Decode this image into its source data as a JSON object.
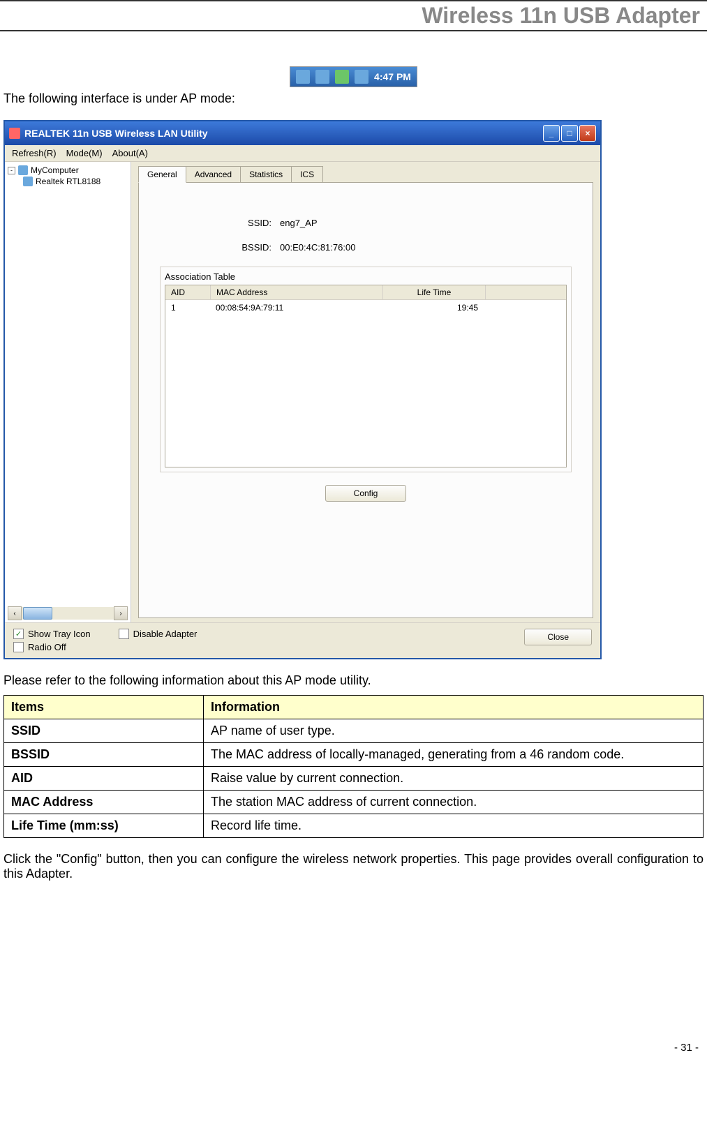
{
  "header_title": "Wireless 11n USB Adapter",
  "tray": {
    "time": "4:47 PM"
  },
  "intro_text": "The following interface is under AP mode:",
  "app": {
    "title": "REALTEK 11n USB Wireless LAN Utility",
    "menu": {
      "refresh": "Refresh(R)",
      "mode": "Mode(M)",
      "about": "About(A)"
    },
    "tree": {
      "root": "MyComputer",
      "child": "Realtek RTL8188"
    },
    "tabs": {
      "general": "General",
      "advanced": "Advanced",
      "statistics": "Statistics",
      "ics": "ICS"
    },
    "fields": {
      "ssid_label": "SSID:",
      "ssid_value": "eng7_AP",
      "bssid_label": "BSSID:",
      "bssid_value": "00:E0:4C:81:76:00"
    },
    "fieldset_legend": "Association Table",
    "table_headers": {
      "aid": "AID",
      "mac": "MAC Address",
      "life": "Life Time"
    },
    "table_row": {
      "aid": "1",
      "mac": "00:08:54:9A:79:11",
      "life": "19:45"
    },
    "config_btn": "Config",
    "checks": {
      "show_tray": "Show Tray Icon",
      "radio_off": "Radio Off",
      "disable_adapter": "Disable Adapter"
    },
    "close_btn": "Close"
  },
  "refer_text": "Please refer to the following information about this AP mode utility.",
  "info_table": {
    "header_items": "Items",
    "header_info": "Information",
    "rows": [
      {
        "item": "SSID",
        "info": "AP name of user type."
      },
      {
        "item": "BSSID",
        "info": "The MAC address of locally-managed, generating from a 46 random code."
      },
      {
        "item": "AID",
        "info": "Raise value by current connection."
      },
      {
        "item": "MAC Address",
        "info": "The station MAC address of current connection."
      },
      {
        "item": "Life Time (mm:ss)",
        "info": "Record life time."
      }
    ]
  },
  "footer_text": "Click the \"Config\" button, then you can configure the wireless network properties. This page provides overall configuration to this Adapter.",
  "page_number": "- 31 -"
}
